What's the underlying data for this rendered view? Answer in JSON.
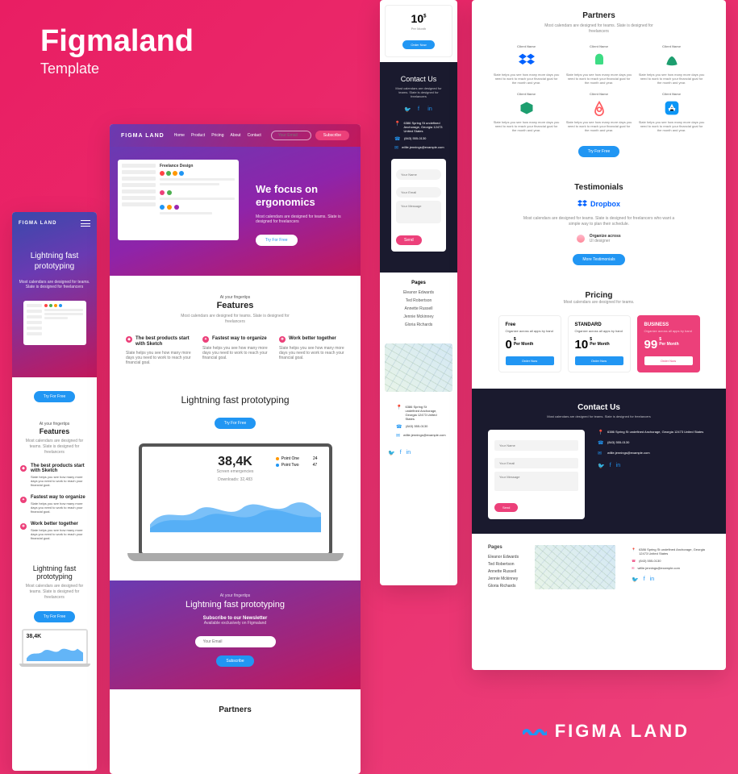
{
  "page": {
    "title": "Figmaland",
    "subtitle": "Template"
  },
  "brand": "FIGMA LAND",
  "common": {
    "logo": "FIGMA LAND",
    "try": "Try For Free",
    "fingertips": "At your fingertips",
    "features_title": "Features",
    "features_sub": "Most calendars are designed for teams. Slate is designed for freelancers",
    "proto_title": "Lightning fast prototyping",
    "proto_sub": "Most calendars are designed for teams. Slate is designed for freelancers",
    "partners_title": "Partners",
    "contact_title": "Contact Us",
    "contact_sub": "Most calendars are designed for teams. Slate is designed for freelancers",
    "send": "Send",
    "order": "Order Now",
    "per_month": "Per Month"
  },
  "nav": {
    "items": [
      "Home",
      "Product",
      "Pricing",
      "About",
      "Contact"
    ],
    "email_ph": "Your Email",
    "subscribe": "Subscribe"
  },
  "heroA": {
    "title": "Lightning fast prototyping",
    "sub": "Most calendars are designed for teams. Slate is designed for freelancers"
  },
  "heroB": {
    "title": "We focus on ergonomics",
    "sub": "Most calendars are designed for teams. Slate is designed for freelancers",
    "mock_title": "Freelance Design"
  },
  "features": [
    {
      "title": "The best products start with Sketch",
      "body": "Slate helps you see how many more days you need to work to reach your financial goal."
    },
    {
      "title": "Fastest way to organize",
      "body": "Slate helps you see how many more days you need to work to reach your financial goal."
    },
    {
      "title": "Work better together",
      "body": "Slate helps you see how many more days you need to work to reach your financial goal."
    }
  ],
  "stats": {
    "number": "38,4K",
    "label": "Screen emergencies",
    "legend1": "Point One",
    "legend1v": "24",
    "legend2": "Point Two",
    "legend2v": "47",
    "downloads": "Downloads: 32,483"
  },
  "newsletter": {
    "title": "Lightning fast prototyping",
    "sub_label": "Subscribe to our Newsletter",
    "avail": "Available exclusively on Figmaland",
    "ph": "Your Email",
    "btn": "Subscribe"
  },
  "price_mobile": {
    "num": "10",
    "cur": "$"
  },
  "contact": {
    "address": "6386 Spring St undefined Anchorage, Georgia 12473 United States",
    "phone": "(843) 555-0130",
    "email": "willie.jennings@example.com",
    "name_ph": "Your Name",
    "email_ph": "Your Email",
    "msg_ph": "Your Message"
  },
  "pages": {
    "title": "Pages",
    "items": [
      "Eleanor Edwards",
      "Ted Robertson",
      "Annette Russell",
      "Jennie Mckinney",
      "Gloria Richards"
    ]
  },
  "partnersD": {
    "items": [
      {
        "name": "Client Name",
        "body": "Slate helps you see how many more days you need to work to reach your financial goal for the month and year."
      },
      {
        "name": "Client Name",
        "body": "Slate helps you see how many more days you need to work to reach your financial goal for the month and year."
      },
      {
        "name": "Client Name",
        "body": "Slate helps you see how many more days you need to work to reach your financial goal for the month and year."
      },
      {
        "name": "Client Name",
        "body": "Slate helps you see how many more days you need to work to reach your financial goal for the month and year."
      },
      {
        "name": "Client Name",
        "body": "Slate helps you see how many more days you need to work to reach your financial goal for the month and year."
      },
      {
        "name": "Client Name",
        "body": "Slate helps you see how many more days you need to work to reach your financial goal for the month and year."
      }
    ]
  },
  "testimonials": {
    "title": "Testimonials",
    "brand": "Dropbox",
    "quote": "Most calendars are designed for teams. Slate is designed for freelancers who want a simple way to plan their schedule.",
    "name": "Organize across",
    "role": "UI designer",
    "more": "More Testimonials"
  },
  "pricing": {
    "title": "Pricing",
    "sub": "Most calendars are designed for teams.",
    "plans": [
      {
        "name": "Free",
        "desc": "Organize across all apps by hand",
        "price": "0",
        "cur": "$"
      },
      {
        "name": "STANDARD",
        "desc": "Organize across all apps by hand",
        "price": "10",
        "cur": "$"
      },
      {
        "name": "BUSINESS",
        "desc": "Organize across all apps by hand",
        "price": "99",
        "cur": "$"
      }
    ]
  }
}
